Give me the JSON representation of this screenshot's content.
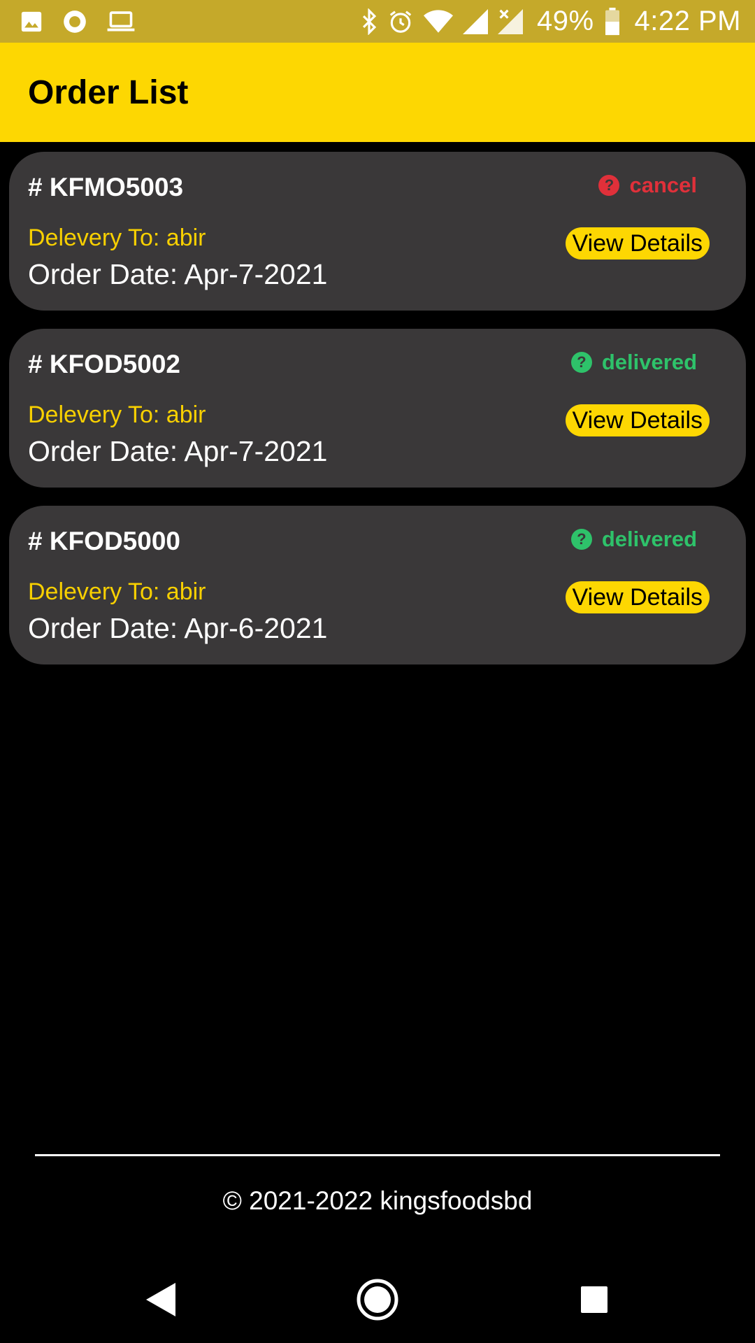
{
  "status_bar": {
    "left_icons": [
      "image-icon",
      "record-icon",
      "laptop-icon"
    ],
    "right_icons": [
      "bluetooth-icon",
      "alarm-icon",
      "wifi-icon",
      "signal-icon",
      "signal-x-icon"
    ],
    "battery_percent": "49%",
    "time": "4:22 PM"
  },
  "app_bar": {
    "title": "Order List"
  },
  "orders": [
    {
      "id": "# KFMO5003",
      "status": "cancel",
      "status_color": "#e0303a",
      "status_icon": "help-circle-icon",
      "delivery": "Delevery To: abir",
      "date": "Order Date: Apr-7-2021",
      "button_label": "View Details"
    },
    {
      "id": "# KFOD5002",
      "status": "delivered",
      "status_color": "#2ec26a",
      "status_icon": "help-circle-icon",
      "delivery": "Delevery To: abir",
      "date": "Order Date: Apr-7-2021",
      "button_label": "View Details"
    },
    {
      "id": "# KFOD5000",
      "status": "delivered",
      "status_color": "#2ec26a",
      "status_icon": "help-circle-icon",
      "delivery": "Delevery To: abir",
      "date": "Order Date: Apr-6-2021",
      "button_label": "View Details"
    }
  ],
  "footer": {
    "copyright": "© 2021-2022 kingsfoodsbd"
  },
  "nav_bar": {
    "icons": [
      "back-icon",
      "home-icon",
      "recents-icon"
    ]
  },
  "colors": {
    "status_bar": "#c5a92a",
    "app_bar": "#fdd702",
    "card": "#3a3839",
    "delivery_text": "#f8d000",
    "background": "#000000"
  }
}
